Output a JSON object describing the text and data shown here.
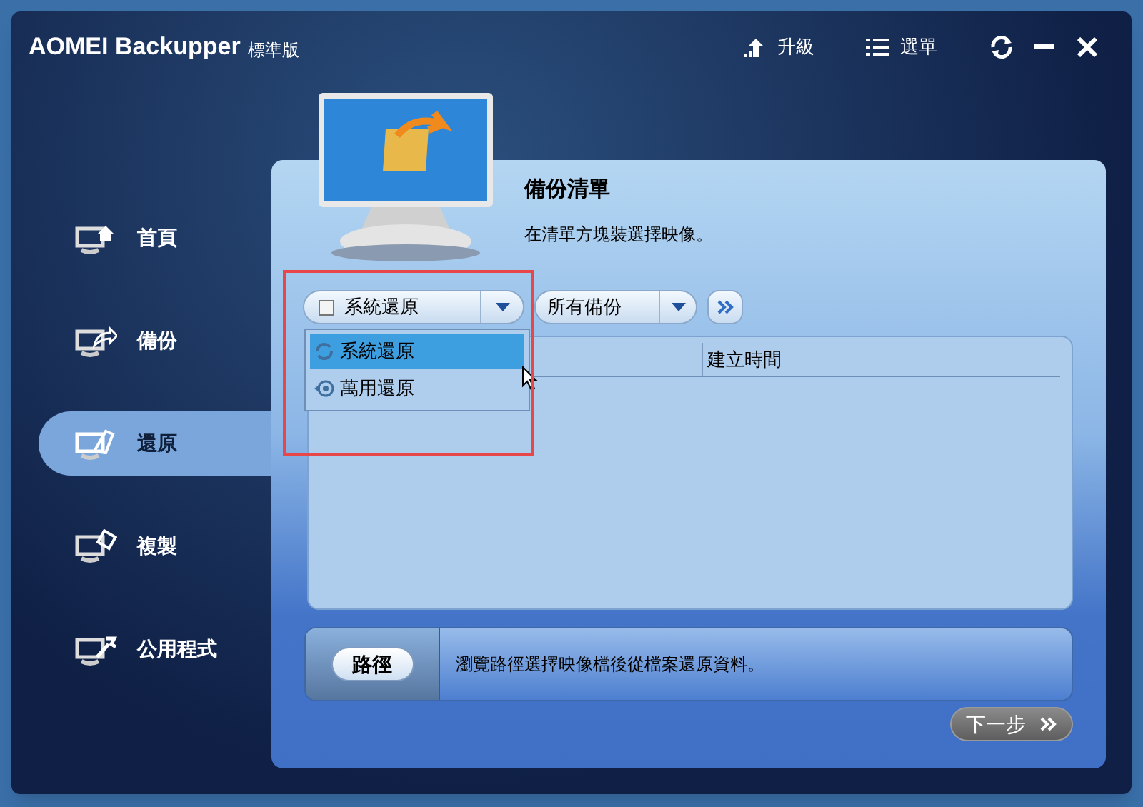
{
  "window": {
    "title": "AOMEI Backupper",
    "edition": "標準版",
    "actions": [
      {
        "kind": "upgrade",
        "label": "升級"
      },
      {
        "kind": "menu",
        "label": "選單"
      }
    ]
  },
  "sidebar": {
    "items": [
      {
        "kind": "home",
        "label": "首頁",
        "selected": false
      },
      {
        "kind": "backup",
        "label": "備份",
        "selected": false
      },
      {
        "kind": "restore",
        "label": "還原",
        "selected": true
      },
      {
        "kind": "clone",
        "label": "複製",
        "selected": false
      },
      {
        "kind": "tools",
        "label": "公用程式",
        "selected": false
      }
    ]
  },
  "panel": {
    "title": "備份清單",
    "subtitle": "在清單方塊裝選擇映像。"
  },
  "restore_type": {
    "value": "系統還原",
    "checked": false,
    "expanded": true,
    "options": [
      {
        "kind": "system",
        "label": "系統還原",
        "selected": true
      },
      {
        "kind": "universal",
        "label": "萬用還原",
        "selected": false
      }
    ]
  },
  "backup_filter": {
    "value": "所有備份"
  },
  "table": {
    "columns": [
      {
        "label": "建立時間"
      }
    ]
  },
  "path": {
    "button": "路徑",
    "hint": "瀏覽路徑選擇映像檔後從檔案還原資料。"
  },
  "next_button": {
    "label": "下一步"
  }
}
